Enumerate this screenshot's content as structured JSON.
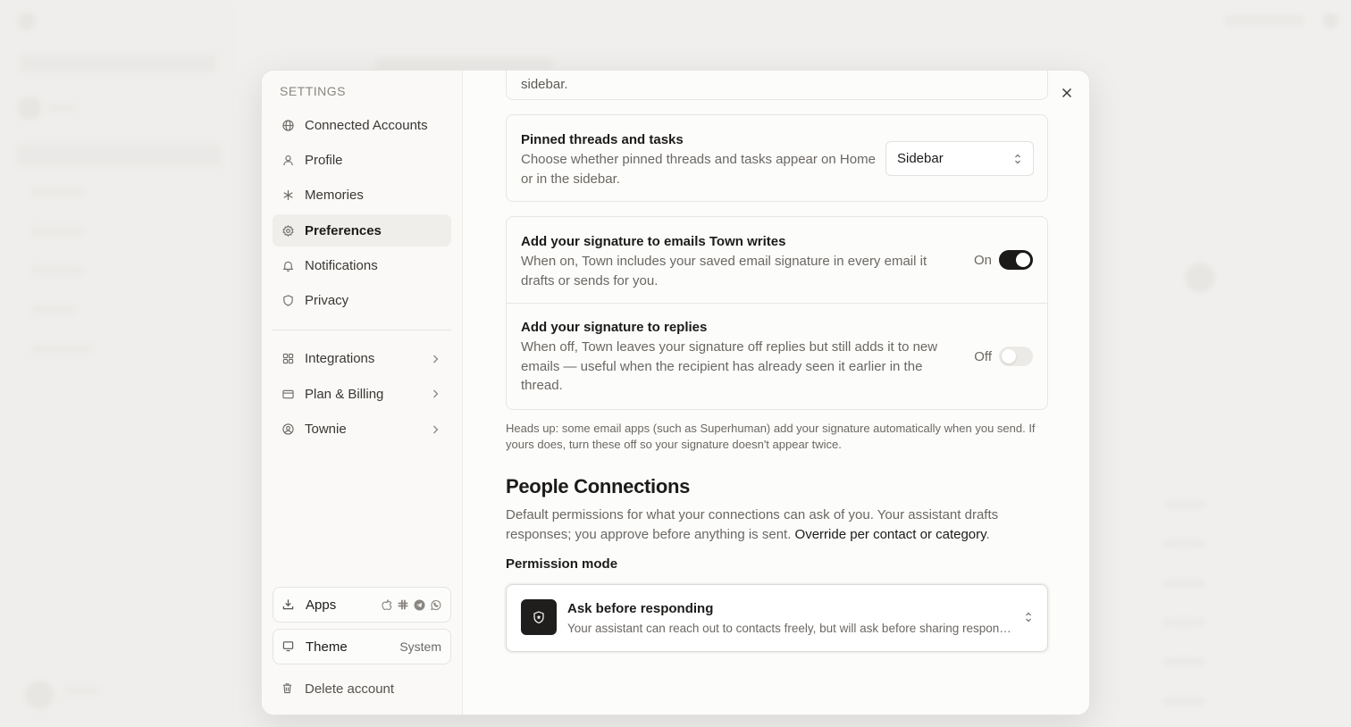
{
  "settings": {
    "heading": "SETTINGS",
    "nav": [
      {
        "label": "Connected Accounts",
        "icon": "globe-icon"
      },
      {
        "label": "Profile",
        "icon": "user-icon"
      },
      {
        "label": "Memories",
        "icon": "asterisk-icon"
      },
      {
        "label": "Preferences",
        "icon": "gear-icon",
        "active": true
      },
      {
        "label": "Notifications",
        "icon": "bell-icon"
      },
      {
        "label": "Privacy",
        "icon": "shield-icon"
      }
    ],
    "nav_sub": [
      {
        "label": "Integrations",
        "icon": "grid-icon"
      },
      {
        "label": "Plan & Billing",
        "icon": "credit-card-icon"
      },
      {
        "label": "Townie",
        "icon": "user-circle-icon"
      }
    ],
    "apps_label": "Apps",
    "app_icons": [
      "apple-icon",
      "slack-icon",
      "telegram-icon",
      "whatsapp-icon"
    ],
    "theme_label": "Theme",
    "theme_value": "System",
    "delete_label": "Delete account"
  },
  "preferences": {
    "top_card_text": "sidebar.",
    "pinned": {
      "title": "Pinned threads and tasks",
      "desc": "Choose whether pinned threads and tasks appear on Home or in the sidebar.",
      "value": "Sidebar"
    },
    "signature_emails": {
      "title": "Add your signature to emails Town writes",
      "desc": "When on, Town includes your saved email signature in every email it drafts or sends for you.",
      "state_label": "On",
      "enabled": true
    },
    "signature_replies": {
      "title": "Add your signature to replies",
      "desc": "When off, Town leaves your signature off replies but still adds it to new emails — useful when the recipient has already seen it earlier in the thread.",
      "state_label": "Off",
      "enabled": false
    },
    "note": "Heads up: some email apps (such as Superhuman) add your signature automatically when you send. If yours does, turn these off so your signature doesn't appear twice.",
    "people": {
      "title": "People Connections",
      "desc": "Default permissions for what your connections can ask of you. Your assistant drafts responses; you approve before anything is sent.",
      "link": "Override per contact or category",
      "link_suffix": ".",
      "perm_label": "Permission mode",
      "mode_title": "Ask before responding",
      "mode_desc": "Your assistant can reach out to contacts freely, but will ask before sharing responses"
    }
  },
  "colors": {
    "accent": "#1c1b19",
    "muted_text": "#6b6863",
    "background": "#f1f0ee"
  }
}
